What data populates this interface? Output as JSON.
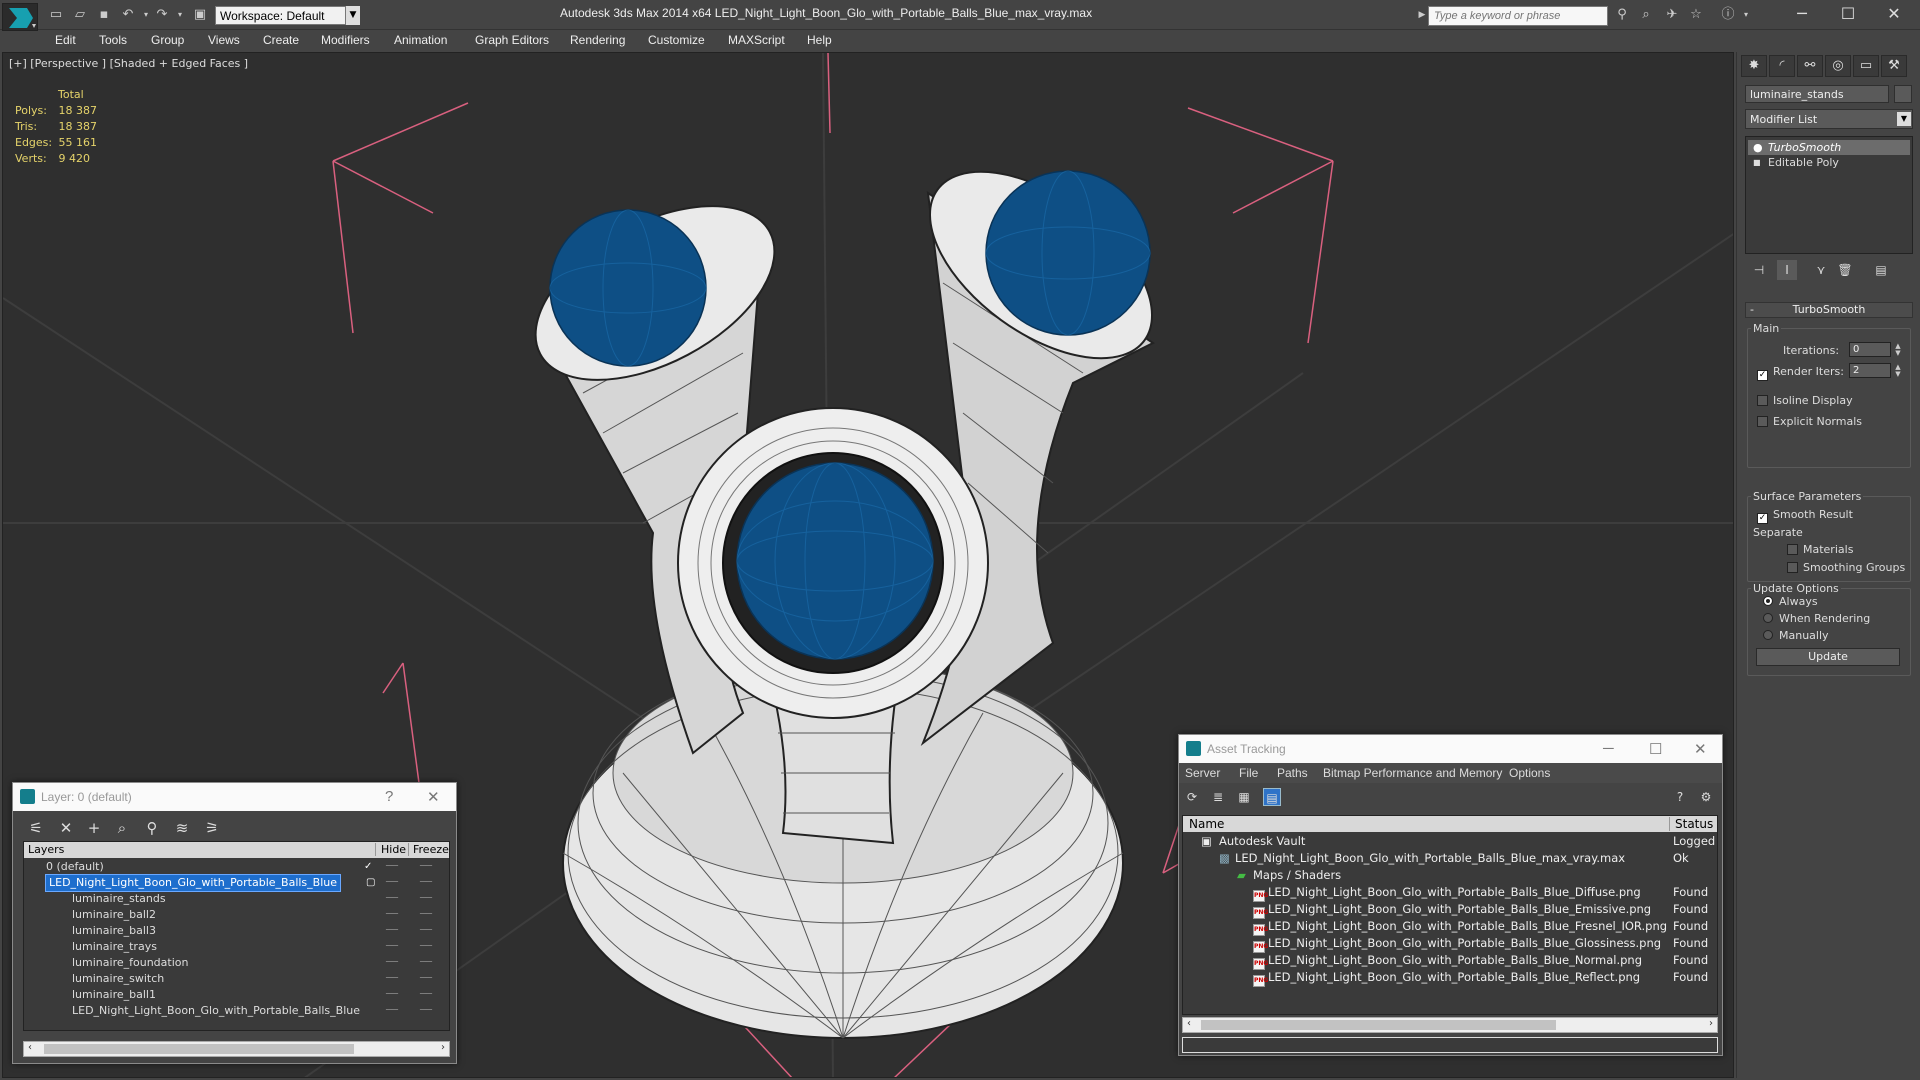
{
  "app": {
    "window_title": "Autodesk 3ds Max  2014 x64      LED_Night_Light_Boon_Glo_with_Portable_Balls_Blue_max_vray.max",
    "workspace": "Workspace: Default",
    "search_placeholder": "Type a keyword or phrase"
  },
  "menu": [
    "Edit",
    "Tools",
    "Group",
    "Views",
    "Create",
    "Modifiers",
    "Animation",
    "Graph Editors",
    "Rendering",
    "Customize",
    "MAXScript",
    "Help"
  ],
  "viewport": {
    "label": "[+] [Perspective ] [Shaded + Edged Faces ]",
    "stats": {
      "header": "Total",
      "polys_label": "Polys:",
      "polys": "18 387",
      "tris_label": "Tris:",
      "tris": "18 387",
      "edges_label": "Edges:",
      "edges": "55 161",
      "verts_label": "Verts:",
      "verts": "9 420"
    },
    "colors": {
      "background": "#2f2f2f",
      "mesh": "#e6e6e6",
      "ball": "#0e4f85",
      "bracket": "#d9607f"
    }
  },
  "command_panel": {
    "object_name": "luminaire_stands",
    "modifier_list": "Modifier List",
    "stack": [
      "TurboSmooth",
      "Editable Poly"
    ],
    "rollout_title": "TurboSmooth",
    "main_group": "Main",
    "iterations_label": "Iterations:",
    "iterations": "0",
    "render_iters_label": "Render Iters:",
    "render_iters": "2",
    "isoline_display": "Isoline Display",
    "explicit_normals": "Explicit Normals",
    "surface_group": "Surface Parameters",
    "smooth_result": "Smooth Result",
    "separate_label": "Separate",
    "materials": "Materials",
    "smoothing_groups": "Smoothing Groups",
    "update_group": "Update Options",
    "always": "Always",
    "when_rendering": "When Rendering",
    "manually": "Manually",
    "update_button": "Update"
  },
  "layer_dialog": {
    "title": "Layer: 0 (default)",
    "help": "?",
    "columns": [
      "Layers",
      "Hide",
      "Freeze"
    ],
    "rows": [
      "0 (default)",
      "LED_Night_Light_Boon_Glo_with_Portable_Balls_Blue",
      "luminaire_stands",
      "luminaire_ball2",
      "luminaire_ball3",
      "luminaire_trays",
      "luminaire_foundation",
      "luminaire_switch",
      "luminaire_ball1",
      "LED_Night_Light_Boon_Glo_with_Portable_Balls_Blue"
    ]
  },
  "asset_dialog": {
    "title": "Asset Tracking",
    "menu": [
      "Server",
      "File",
      "Paths",
      "Bitmap Performance and Memory",
      "Options"
    ],
    "columns": [
      "Name",
      "Status"
    ],
    "rows": [
      {
        "name": "Autodesk Vault",
        "status": "Logged O"
      },
      {
        "name": "LED_Night_Light_Boon_Glo_with_Portable_Balls_Blue_max_vray.max",
        "status": "Ok"
      },
      {
        "name": "Maps / Shaders",
        "status": ""
      },
      {
        "name": "LED_Night_Light_Boon_Glo_with_Portable_Balls_Blue_Diffuse.png",
        "status": "Found"
      },
      {
        "name": "LED_Night_Light_Boon_Glo_with_Portable_Balls_Blue_Emissive.png",
        "status": "Found"
      },
      {
        "name": "LED_Night_Light_Boon_Glo_with_Portable_Balls_Blue_Fresnel_IOR.png",
        "status": "Found"
      },
      {
        "name": "LED_Night_Light_Boon_Glo_with_Portable_Balls_Blue_Glossiness.png",
        "status": "Found"
      },
      {
        "name": "LED_Night_Light_Boon_Glo_with_Portable_Balls_Blue_Normal.png",
        "status": "Found"
      },
      {
        "name": "LED_Night_Light_Boon_Glo_with_Portable_Balls_Blue_Reflect.png",
        "status": "Found"
      }
    ]
  }
}
